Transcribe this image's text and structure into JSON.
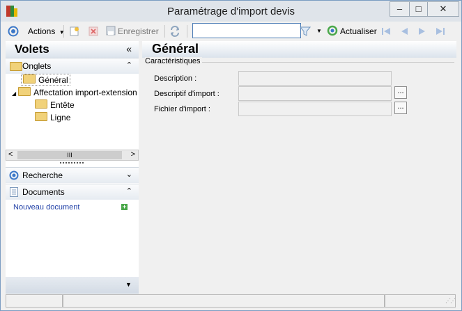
{
  "window": {
    "title": "Paramétrage d'import devis",
    "minimize_glyph": "–",
    "maximize_glyph": "□",
    "close_glyph": "✕"
  },
  "toolbar": {
    "actions_label": "Actions",
    "save_label": "Enregistrer",
    "search_value": "",
    "refresh_label": "Actualiser"
  },
  "left_pane": {
    "title": "Volets",
    "collapse_glyph": "«",
    "onglets": {
      "label": "Onglets",
      "items": [
        {
          "label": "Général"
        },
        {
          "label": "Affectation import-extension"
        },
        {
          "label": "Entête"
        },
        {
          "label": "Ligne"
        }
      ]
    },
    "scroll": {
      "left": "<",
      "thumb": "III",
      "right": ">"
    },
    "recherche": {
      "label": "Recherche"
    },
    "documents": {
      "label": "Documents",
      "new_doc_label": "Nouveau document"
    }
  },
  "main": {
    "title": "Général",
    "group_label": "Caractéristiques",
    "fields": [
      {
        "label": "Description :",
        "value": ""
      },
      {
        "label": "Descriptif d'import :",
        "value": ""
      },
      {
        "label": "Fichier d'import :",
        "value": ""
      }
    ],
    "browse_glyph": "..."
  },
  "colors": {
    "accent": "#3c78c8",
    "header_blue": "#dbe3ec",
    "green": "#4aa84a"
  }
}
